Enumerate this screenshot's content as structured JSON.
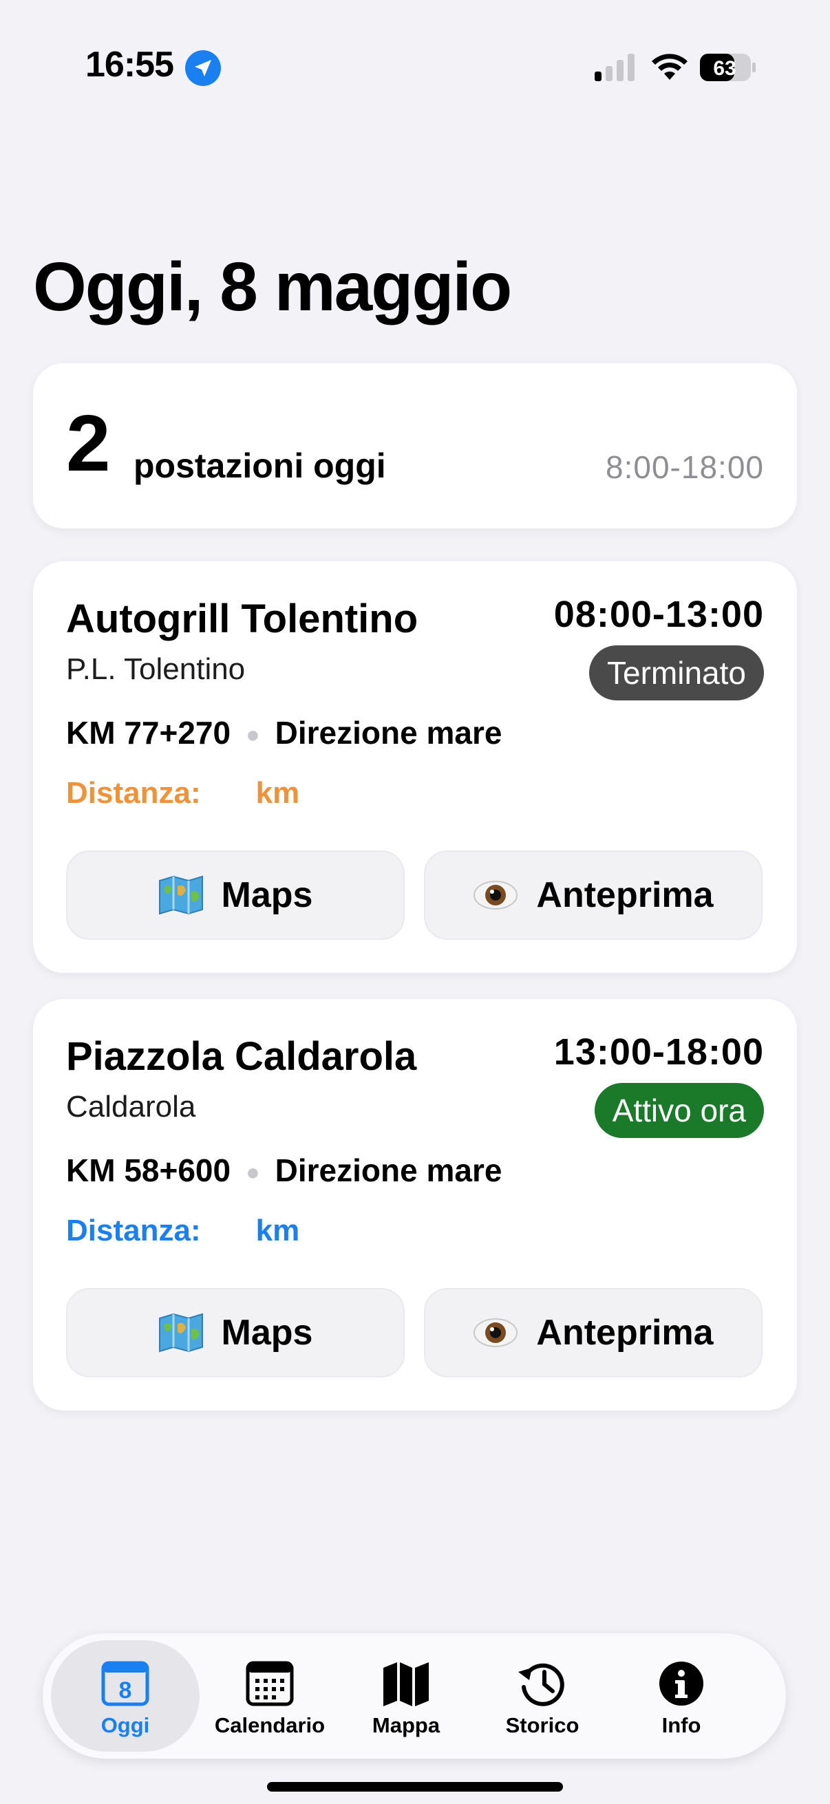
{
  "status_bar": {
    "time": "16:55",
    "battery": "63"
  },
  "page": {
    "title": "Oggi, 8 maggio"
  },
  "summary": {
    "count": "2",
    "label": "postazioni oggi",
    "hours": "8:00-18:00"
  },
  "locations": [
    {
      "name": "Autogrill Tolentino",
      "subtitle": "P.L. Tolentino",
      "time_range": "08:00-13:00",
      "status": "Terminato",
      "status_color": "#4a4a4a",
      "km": "KM 77+270",
      "direction": "Direzione mare",
      "distance_label": "Distanza:",
      "distance_unit": "km",
      "distance_color": "#f0923a",
      "maps_label": "Maps",
      "preview_label": "Anteprima"
    },
    {
      "name": "Piazzola Caldarola",
      "subtitle": "Caldarola",
      "time_range": "13:00-18:00",
      "status": "Attivo ora",
      "status_color": "#1a7a2a",
      "km": "KM 58+600",
      "direction": "Direzione mare",
      "distance_label": "Distanza:",
      "distance_unit": "km",
      "distance_color": "#1a7ff0",
      "maps_label": "Maps",
      "preview_label": "Anteprima"
    }
  ],
  "tabs": [
    {
      "label": "Oggi",
      "icon": "calendar-day-icon",
      "day": "8",
      "active": true
    },
    {
      "label": "Calendario",
      "icon": "calendar-grid-icon"
    },
    {
      "label": "Mappa",
      "icon": "map-icon"
    },
    {
      "label": "Storico",
      "icon": "history-icon"
    },
    {
      "label": "Info",
      "icon": "info-icon"
    }
  ],
  "colors": {
    "accent": "#1a7ff0",
    "background": "#f2f2f7"
  }
}
